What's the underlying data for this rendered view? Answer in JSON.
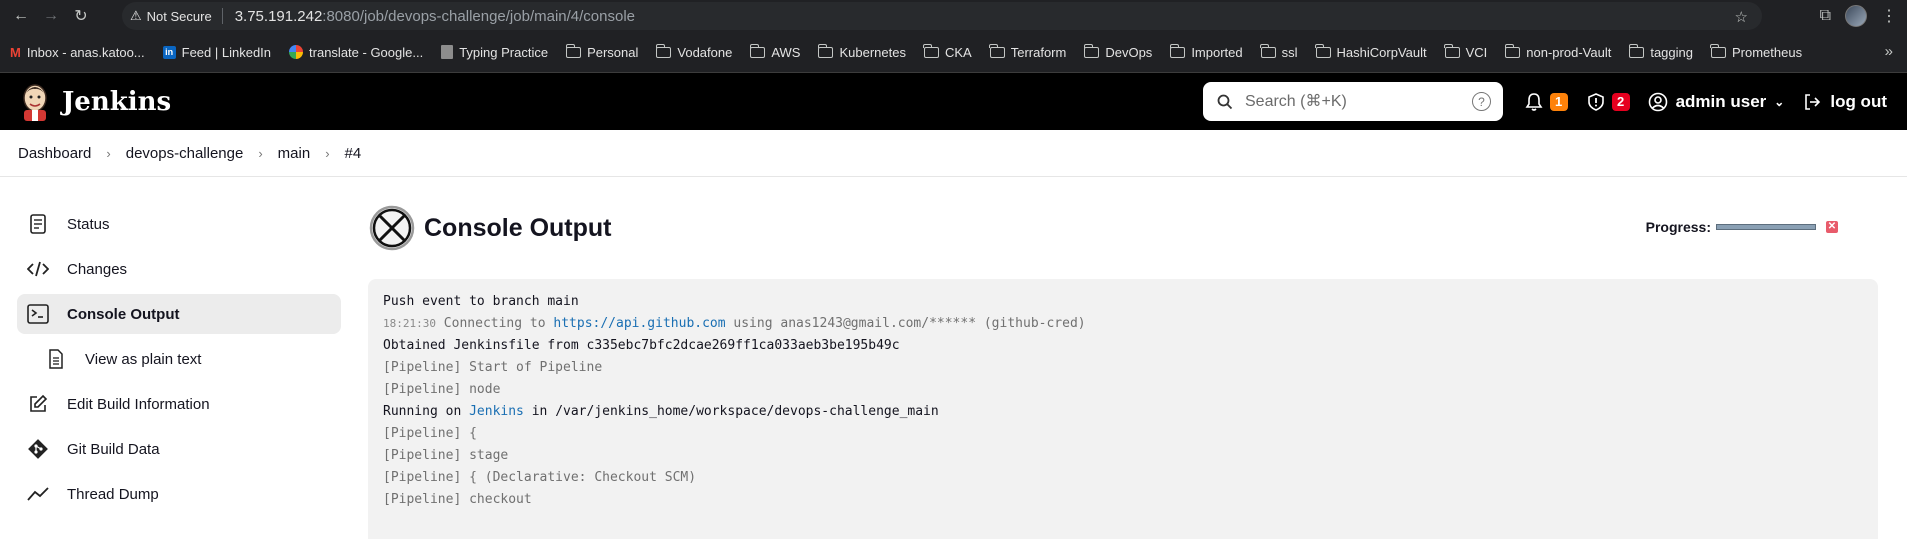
{
  "browser": {
    "security_label": "Not Secure",
    "url_host": "3.75.191.242",
    "url_rest": ":8080/job/devops-challenge/job/main/4/console",
    "bookmarks": [
      {
        "label": "Inbox - anas.katoo..."
      },
      {
        "label": "Feed | LinkedIn"
      },
      {
        "label": "translate - Google..."
      },
      {
        "label": "Typing Practice"
      },
      {
        "label": "Personal"
      },
      {
        "label": "Vodafone"
      },
      {
        "label": "AWS"
      },
      {
        "label": "Kubernetes"
      },
      {
        "label": "CKA"
      },
      {
        "label": "Terraform"
      },
      {
        "label": "DevOps"
      },
      {
        "label": "Imported"
      },
      {
        "label": "ssl"
      },
      {
        "label": "HashiCorpVault"
      },
      {
        "label": "VCI"
      },
      {
        "label": "non-prod-Vault"
      },
      {
        "label": "tagging"
      },
      {
        "label": "Prometheus"
      }
    ]
  },
  "header": {
    "brand": "Jenkins",
    "search_placeholder": "Search (⌘+K)",
    "help_glyph": "?",
    "notifications_count": "1",
    "security_count": "2",
    "user_name": "admin user",
    "logout_label": "log out"
  },
  "breadcrumb": [
    "Dashboard",
    "devops-challenge",
    "main",
    "#4"
  ],
  "sidebar": {
    "items": [
      {
        "label": "Status",
        "icon": "document-icon"
      },
      {
        "label": "Changes",
        "icon": "code-icon"
      },
      {
        "label": "Console Output",
        "icon": "terminal-icon"
      },
      {
        "label": "View as plain text",
        "icon": "page-icon"
      },
      {
        "label": "Edit Build Information",
        "icon": "edit-icon"
      },
      {
        "label": "Git Build Data",
        "icon": "git-icon"
      },
      {
        "label": "Thread Dump",
        "icon": "activity-icon"
      }
    ]
  },
  "main": {
    "title": "Console Output",
    "progress_label": "Progress:",
    "progress_value": 1.0
  },
  "console": {
    "lines": [
      {
        "text": "Push event to branch main"
      },
      {
        "ts": "18:21:30",
        "pre": " Connecting to ",
        "link": "https://api.github.com",
        "post": " using anas1243@gmail.com/****** (github-cred)"
      },
      {
        "text": "Obtained Jenkinsfile from c335ebc7bfc2dcae269ff1ca033aeb3be195b49c"
      },
      {
        "dim": "[Pipeline] Start of Pipeline"
      },
      {
        "dim": "[Pipeline] node"
      },
      {
        "pre2": "Running on ",
        "link2": "Jenkins",
        "post2": " in /var/jenkins_home/workspace/devops-challenge_main"
      },
      {
        "dim": "[Pipeline] {"
      },
      {
        "dim": "[Pipeline] stage"
      },
      {
        "dim": "[Pipeline] { (Declarative: Checkout SCM)"
      },
      {
        "dim": "[Pipeline] checkout"
      }
    ]
  },
  "colors": {
    "header_bg": "#000000",
    "badge_orange": "#fe820a",
    "badge_red": "#e6001f",
    "link": "#1a6fb3",
    "console_bg": "#f2f2f2"
  }
}
